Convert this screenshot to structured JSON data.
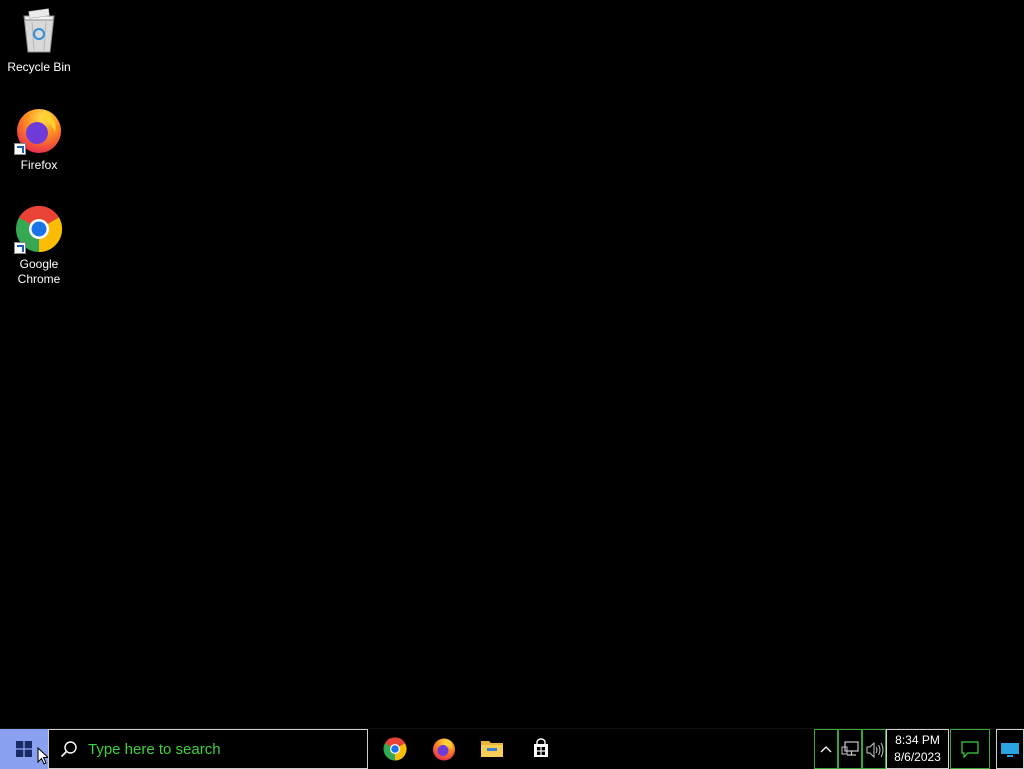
{
  "desktop": {
    "icons": [
      {
        "label": "Recycle Bin",
        "icon": "recycle-bin-icon"
      },
      {
        "label": "Firefox",
        "icon": "firefox-icon"
      },
      {
        "label": "Google Chrome",
        "icon": "chrome-icon"
      }
    ]
  },
  "taskbar": {
    "start_icon": "windows-logo-icon",
    "search": {
      "placeholder": "Type here to search",
      "icon": "search-icon"
    },
    "apps": [
      {
        "name": "Google Chrome",
        "icon": "chrome-icon"
      },
      {
        "name": "Firefox",
        "icon": "firefox-icon"
      },
      {
        "name": "File Explorer",
        "icon": "folder-icon"
      },
      {
        "name": "Microsoft Store",
        "icon": "store-icon"
      }
    ],
    "tray": {
      "icons": [
        "chevron-up-icon",
        "network-icon",
        "volume-icon"
      ],
      "time": "8:34 PM",
      "date": "8/6/2023",
      "notification_icon": "notification-icon",
      "show_desktop_icon": "show-desktop-icon"
    }
  },
  "colors": {
    "desktop_bg": "#000000",
    "start_highlight": "#8aa0f0",
    "search_text": "#3ecf3e",
    "tray_border": "#3aa63a"
  }
}
